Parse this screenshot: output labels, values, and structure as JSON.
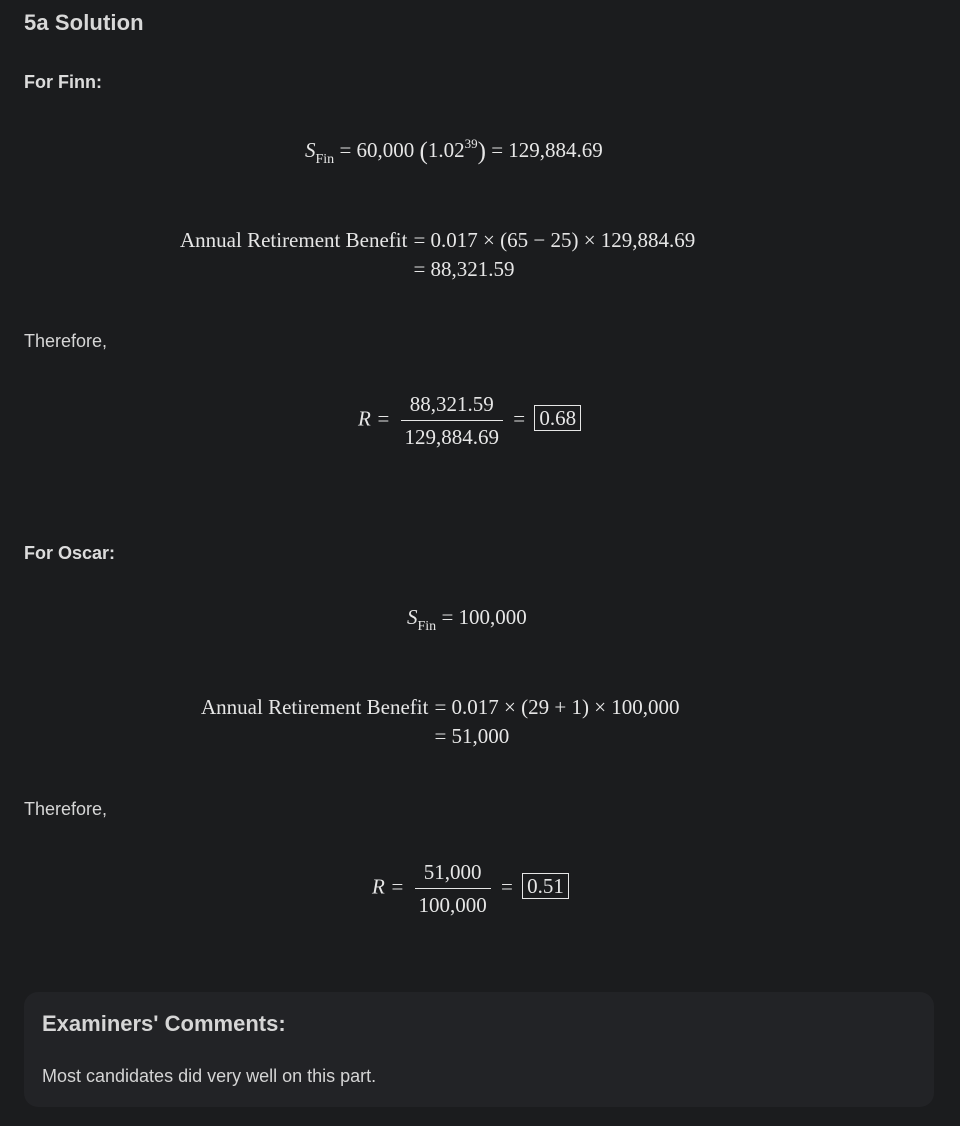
{
  "heading": "5a Solution",
  "finn": {
    "label": "For Finn:",
    "s_var": "S",
    "s_sub": "Fin",
    "s_eq_prefix": "= 60,000",
    "s_base": "1.02",
    "s_exp": "39",
    "s_result": "= 129,884.69",
    "benefit_lhs": "Annual Retirement Benefit",
    "benefit_rhs1": "= 0.017 × (65 − 25) × 129,884.69",
    "benefit_rhs2": "= 88,321.59",
    "therefore": "Therefore,",
    "r_var": "R =",
    "r_num": "88,321.59",
    "r_den": "129,884.69",
    "r_eq": "=",
    "r_result": "0.68"
  },
  "oscar": {
    "label": "For Oscar:",
    "s_var": "S",
    "s_sub": "Fin",
    "s_result": "= 100,000",
    "benefit_lhs": "Annual Retirement Benefit",
    "benefit_rhs1": "= 0.017 × (29 + 1) × 100,000",
    "benefit_rhs2": "= 51,000",
    "therefore": "Therefore,",
    "r_var": "R =",
    "r_num": "51,000",
    "r_den": "100,000",
    "r_eq": "=",
    "r_result": "0.51"
  },
  "examiners": {
    "title": "Examiners' Comments:",
    "text": "Most candidates did very well on this part."
  }
}
